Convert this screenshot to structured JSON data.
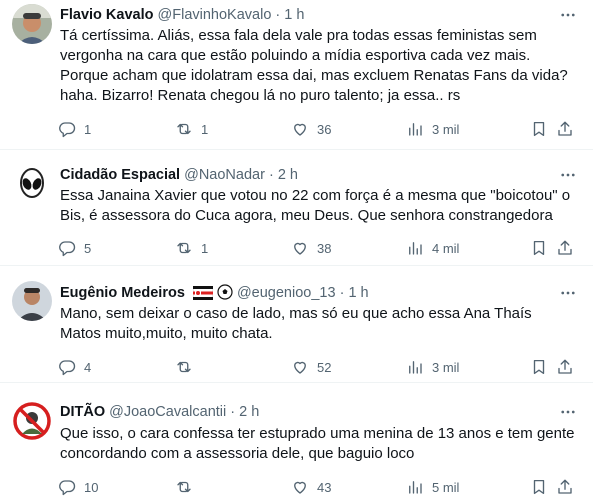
{
  "tweets": [
    {
      "name": "Flavio Kavalo",
      "handle": "@FlavinhoKavalo",
      "separator": "·",
      "time": "1 h",
      "text": "Tá certíssima. Aliás, essa fala dela vale pra todas essas feministas sem vergonha na cara que estão poluindo a mídia esportiva cada vez mais. Porque acham que idolatram essa dai, mas excluem Renatas Fans da vida? haha. Bizarro! Renata chegou lá no puro talento; ja essa.. rs",
      "replies": "1",
      "retweets": "1",
      "likes": "36",
      "views": "3 mil"
    },
    {
      "name": "Cidadão Espacial",
      "handle": "@NaoNadar",
      "separator": "·",
      "time": "2 h",
      "text": "Essa Janaina Xavier que votou no 22 com força é a mesma que \"boicotou\" o Bis, é assessora do Cuca agora, meu Deus. Que senhora constrangedora",
      "replies": "5",
      "retweets": "1",
      "likes": "38",
      "views": "4 mil"
    },
    {
      "name": "Eugênio Medeiros",
      "handle": "@eugenioo_13",
      "separator": "·",
      "time": "1 h",
      "text": "Mano, sem deixar o caso de lado, mas só eu que acho essa Ana Thaís Matos muito,muito, muito chata.",
      "replies": "4",
      "retweets": "",
      "likes": "52",
      "views": "3 mil"
    },
    {
      "name": "DITÃO",
      "handle": "@JoaoCavalcantii",
      "separator": "·",
      "time": "2 h",
      "text": "Que isso, o cara confessa ter estuprado uma menina de 13 anos e tem gente concordando com a assessoria dele, que baguio loco",
      "replies": "10",
      "retweets": "",
      "likes": "43",
      "views": "5 mil"
    }
  ],
  "icons": {
    "reply": "reply-icon",
    "retweet": "retweet-icon",
    "like": "heart-icon",
    "views": "views-chart-icon",
    "bookmark": "bookmark-icon",
    "share": "share-icon",
    "more": "more-options-icon"
  },
  "colors": {
    "text": "#0f1419",
    "secondary": "#536471",
    "divider": "#eff3f4"
  }
}
